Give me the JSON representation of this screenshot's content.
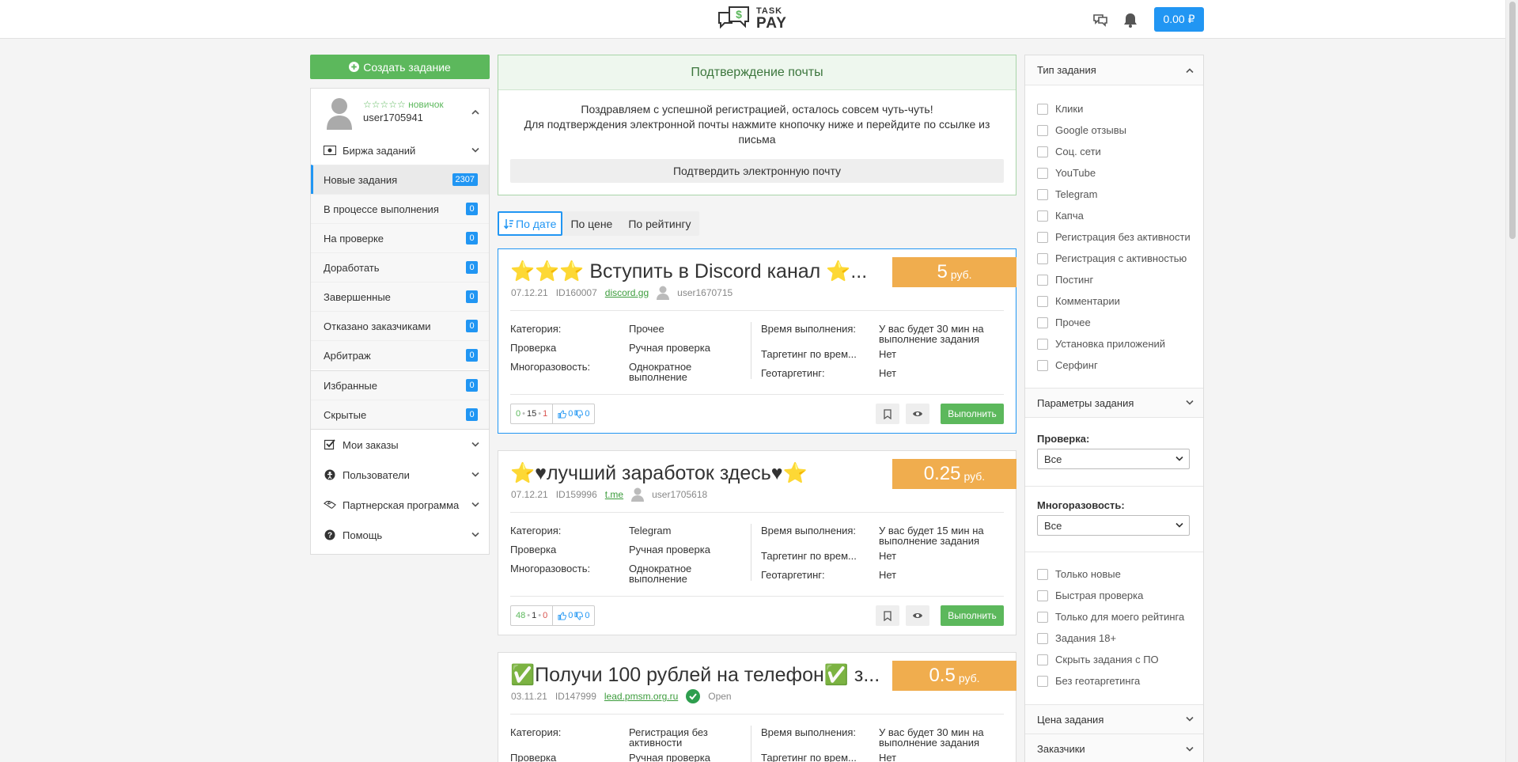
{
  "header": {
    "logo_top": "TASK",
    "logo_bottom": "PAY",
    "balance": "0.00 ₽"
  },
  "sidebar": {
    "create_button": "Создать задание",
    "rank": "☆☆☆☆☆ новичок",
    "username": "user1705941",
    "exchange_label": "Биржа заданий",
    "items": [
      {
        "label": "Новые задания",
        "count": "2307"
      },
      {
        "label": "В процессе выполнения",
        "count": "0"
      },
      {
        "label": "На проверке",
        "count": "0"
      },
      {
        "label": "Доработать",
        "count": "0"
      },
      {
        "label": "Завершенные",
        "count": "0"
      },
      {
        "label": "Отказано заказчиками",
        "count": "0"
      },
      {
        "label": "Арбитраж",
        "count": "0"
      },
      {
        "label": "Избранные",
        "count": "0"
      },
      {
        "label": "Скрытые",
        "count": "0"
      }
    ],
    "sections": {
      "my_orders": "Мои заказы",
      "users": "Пользователи",
      "partner": "Партнерская программа",
      "help": "Помощь"
    }
  },
  "email_confirm": {
    "title": "Подтверждение почты",
    "line1": "Поздравляем с успешной регистрацией, осталось совсем чуть-чуть!",
    "line2": "Для подтверждения электронной почты нажмите кнопочку ниже и перейдите по ссылке из",
    "line3": "письма",
    "button": "Подтвердить электронную почту"
  },
  "sort": {
    "by_date": "По дате",
    "by_price": "По цене",
    "by_rating": "По рейтингу"
  },
  "labels": {
    "category": "Категория:",
    "check": "Проверка",
    "reusable": "Многоразовость:",
    "exec_time": "Время выполнения:",
    "time_targeting": "Таргетинг по врем...",
    "geo_targeting": "Геотаргетинг:",
    "execute": "Выполнить",
    "currency": "руб."
  },
  "tasks": [
    {
      "title": "⭐⭐⭐ Вступить в Discord канал ⭐...",
      "price": "5",
      "date": "07.12.21",
      "id": "ID160007",
      "domain": "discord.gg",
      "author": "user1670715",
      "category": "Прочее",
      "check": "Ручная проверка",
      "reusable": "Однократное выполнение",
      "exec_time": "У вас будет 30 мин на выполнение задания",
      "time_targeting": "Нет",
      "geo_targeting": "Нет",
      "stat_done": "0",
      "stat_mid": "15",
      "stat_fail": "1",
      "likes": "0",
      "dislikes": "0"
    },
    {
      "title": "⭐♥лучший заработок здесь♥⭐",
      "price": "0.25",
      "date": "07.12.21",
      "id": "ID159996",
      "domain": "t.me",
      "author": "user1705618",
      "category": "Telegram",
      "check": "Ручная проверка",
      "reusable": "Однократное выполнение",
      "exec_time": "У вас будет 15 мин на выполнение задания",
      "time_targeting": "Нет",
      "geo_targeting": "Нет",
      "stat_done": "48",
      "stat_mid": "1",
      "stat_fail": "0",
      "likes": "0",
      "dislikes": "0"
    },
    {
      "title": "✅Получи 100 рублей на телефон✅ з...",
      "price": "0.5",
      "date": "03.11.21",
      "id": "ID147999",
      "domain": "lead.pmsm.org.ru",
      "author": "Open",
      "category": "Регистрация без активности",
      "check": "Ручная проверка",
      "exec_time": "У вас будет 30 мин на выполнение задания",
      "time_targeting": "Нет"
    }
  ],
  "filters": {
    "type_title": "Тип задания",
    "types": [
      "Клики",
      "Google отзывы",
      "Соц. сети",
      "YouTube",
      "Telegram",
      "Капча",
      "Регистрация без активности",
      "Регистрация с активностью",
      "Постинг",
      "Комментарии",
      "Прочее",
      "Установка приложений",
      "Серфинг"
    ],
    "params_title": "Параметры задания",
    "check_label": "Проверка:",
    "check_value": "Все",
    "reuse_label": "Многоразовость:",
    "reuse_value": "Все",
    "extra": [
      "Только новые",
      "Быстрая проверка",
      "Только для моего рейтинга",
      "Задания 18+",
      "Скрыть задания с ПО",
      "Без геотаргетинга"
    ],
    "price_title": "Цена задания",
    "customers_title": "Заказчики"
  }
}
